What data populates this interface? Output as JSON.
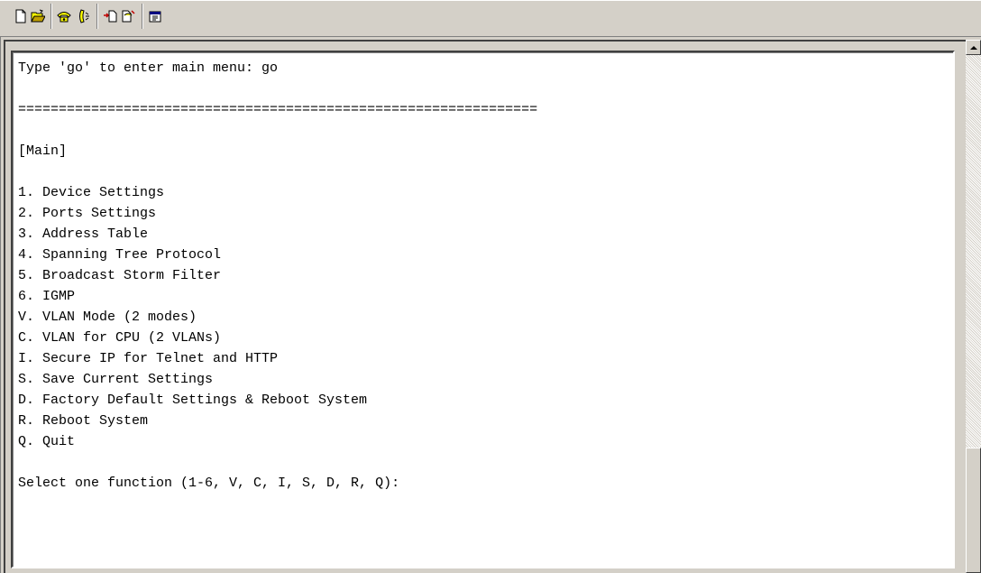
{
  "toolbar": {
    "buttons": [
      {
        "name": "new-icon"
      },
      {
        "name": "open-icon"
      },
      {
        "name": "connect-icon"
      },
      {
        "name": "disconnect-icon"
      },
      {
        "name": "send-icon"
      },
      {
        "name": "receive-icon"
      },
      {
        "name": "properties-icon"
      }
    ]
  },
  "terminal": {
    "lines": [
      "Type 'go' to enter main menu: go",
      "",
      "================================================================",
      "",
      "[Main]",
      "",
      "1. Device Settings",
      "2. Ports Settings",
      "3. Address Table",
      "4. Spanning Tree Protocol",
      "5. Broadcast Storm Filter",
      "6. IGMP",
      "V. VLAN Mode (2 modes)",
      "C. VLAN for CPU (2 VLANs)",
      "I. Secure IP for Telnet and HTTP",
      "S. Save Current Settings",
      "D. Factory Default Settings & Reboot System",
      "R. Reboot System",
      "Q. Quit",
      "",
      "Select one function (1-6, V, C, I, S, D, R, Q):"
    ]
  }
}
